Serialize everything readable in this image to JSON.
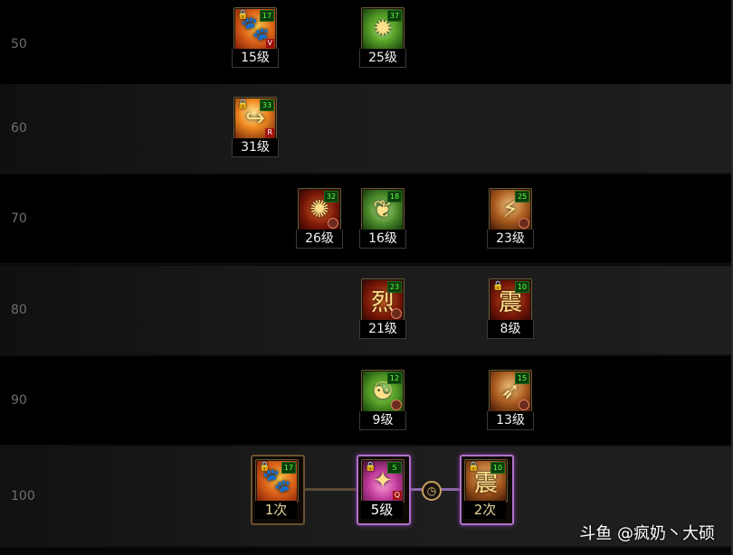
{
  "rows": [
    {
      "level": "50"
    },
    {
      "level": "60"
    },
    {
      "level": "70"
    },
    {
      "level": "80"
    },
    {
      "level": "90"
    },
    {
      "level": "100"
    }
  ],
  "skills": [
    {
      "id": "r50a",
      "caption": "15级",
      "badge": "17",
      "locked": true,
      "hotkey": "V",
      "art": "🐾",
      "theme": "orange"
    },
    {
      "id": "r50b",
      "caption": "25级",
      "badge": "37",
      "locked": false,
      "hotkey": "",
      "art": "✹",
      "theme": "green"
    },
    {
      "id": "r60a",
      "caption": "31级",
      "badge": "33",
      "locked": true,
      "hotkey": "R",
      "art": "↪",
      "theme": "fire"
    },
    {
      "id": "r70a",
      "caption": "26级",
      "badge": "32",
      "locked": false,
      "hotkey": "",
      "art": "✺",
      "theme": "red",
      "cooldown": true
    },
    {
      "id": "r70b",
      "caption": "16级",
      "badge": "18",
      "locked": false,
      "hotkey": "",
      "art": "❦",
      "theme": "leaf"
    },
    {
      "id": "r70c",
      "caption": "23级",
      "badge": "25",
      "locked": false,
      "hotkey": "",
      "art": "⚡",
      "theme": "tan",
      "cooldown": true
    },
    {
      "id": "r80a",
      "caption": "21级",
      "badge": "23",
      "locked": false,
      "hotkey": "",
      "art": "烈",
      "theme": "red",
      "cooldown": true
    },
    {
      "id": "r80b",
      "caption": "8级",
      "badge": "10",
      "locked": true,
      "hotkey": "",
      "art": "震",
      "theme": "red"
    },
    {
      "id": "r90a",
      "caption": "9级",
      "badge": "12",
      "locked": false,
      "hotkey": "",
      "art": "☯",
      "theme": "green",
      "cooldown": true
    },
    {
      "id": "r90b",
      "caption": "13级",
      "badge": "15",
      "locked": false,
      "hotkey": "",
      "art": "➶",
      "theme": "tan",
      "cooldown": true
    },
    {
      "id": "r100a",
      "caption": "1次",
      "badge": "17",
      "locked": true,
      "hotkey": "",
      "art": "🐾",
      "theme": "orange"
    },
    {
      "id": "r100b",
      "caption": "5级",
      "badge": "5",
      "locked": true,
      "hotkey": "Q",
      "art": "✦",
      "theme": "pink"
    },
    {
      "id": "r100c",
      "caption": "2次",
      "badge": "10",
      "locked": true,
      "hotkey": "",
      "art": "震",
      "theme": "tan"
    }
  ],
  "timer_icon": "clock-icon",
  "lock_icon": "lock-icon",
  "watermark": "斗鱼 @疯奶丶大硕"
}
